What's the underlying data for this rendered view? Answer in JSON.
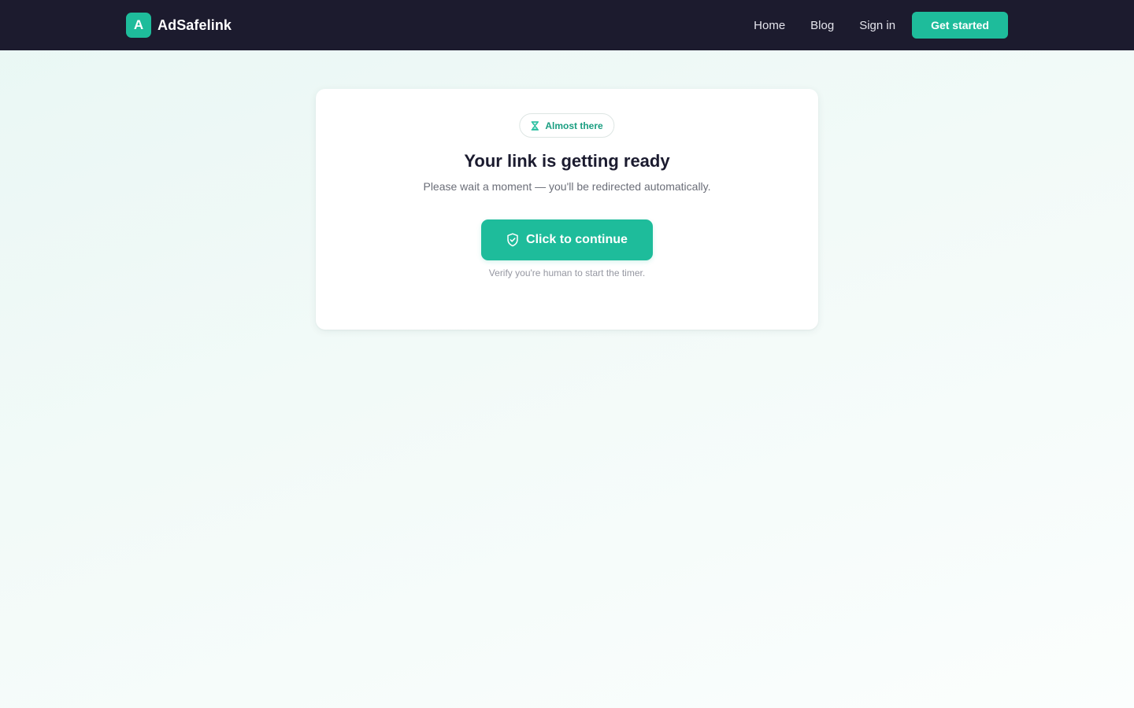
{
  "header": {
    "brand_letter": "A",
    "brand_name": "AdSafelink",
    "nav": [
      "Home",
      "Blog",
      "Sign in"
    ],
    "cta_label": "Get started"
  },
  "card": {
    "badge_icon": "hourglass-icon",
    "badge_text": "Almost there",
    "title": "Your link is getting ready",
    "subtitle": "Please wait a moment — you'll be redirected automatically.",
    "button_icon": "shield-check-icon",
    "button_label": "Click to continue",
    "hint": "Verify you're human to start the timer."
  },
  "colors": {
    "navbar": "#1c1b2e",
    "accent": "#1ebc9b",
    "accent_text": "#1a9e81",
    "title": "#1b1b2f",
    "muted": "#6b6e78"
  }
}
